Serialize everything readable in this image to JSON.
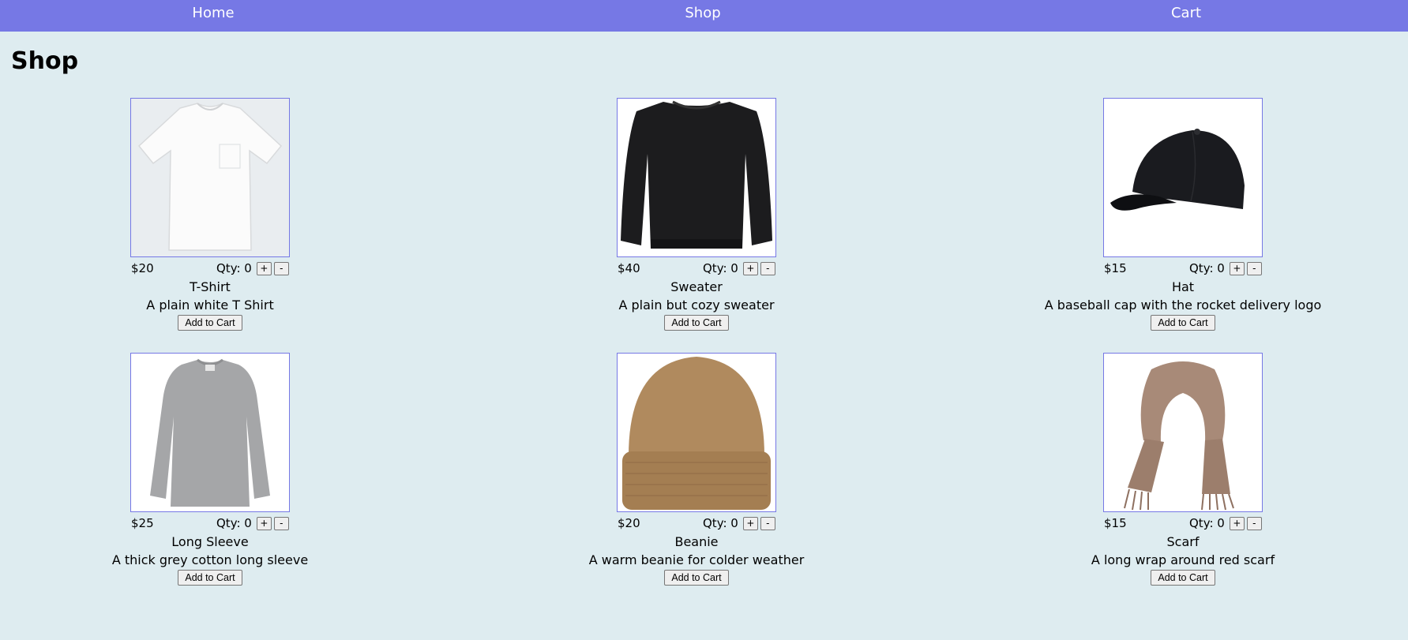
{
  "nav": {
    "home": "Home",
    "shop": "Shop",
    "cart": "Cart"
  },
  "page_title": "Shop",
  "products": [
    {
      "price": "$20",
      "qty_label": "Qty: 0",
      "name": "T-Shirt",
      "description": "A plain white T Shirt",
      "add_label": "Add to Cart",
      "plus": "+",
      "minus": "-",
      "image": "tshirt-image"
    },
    {
      "price": "$40",
      "qty_label": "Qty: 0",
      "name": "Sweater",
      "description": "A plain but cozy sweater",
      "add_label": "Add to Cart",
      "plus": "+",
      "minus": "-",
      "image": "sweater-image"
    },
    {
      "price": "$15",
      "qty_label": "Qty: 0",
      "name": "Hat",
      "description": "A baseball cap with the rocket delivery logo",
      "add_label": "Add to Cart",
      "plus": "+",
      "minus": "-",
      "image": "cap-image"
    },
    {
      "price": "$25",
      "qty_label": "Qty: 0",
      "name": "Long Sleeve",
      "description": "A thick grey cotton long sleeve",
      "add_label": "Add to Cart",
      "plus": "+",
      "minus": "-",
      "image": "long-sleeve-image"
    },
    {
      "price": "$20",
      "qty_label": "Qty: 0",
      "name": "Beanie",
      "description": "A warm beanie for colder weather",
      "add_label": "Add to Cart",
      "plus": "+",
      "minus": "-",
      "image": "beanie-image"
    },
    {
      "price": "$15",
      "qty_label": "Qty: 0",
      "name": "Scarf",
      "description": "A long wrap around red scarf",
      "add_label": "Add to Cart",
      "plus": "+",
      "minus": "-",
      "image": "scarf-image"
    }
  ],
  "colors": {
    "nav_bg": "#7678e5",
    "page_bg": "#deecf0",
    "image_border": "#7678e5"
  }
}
